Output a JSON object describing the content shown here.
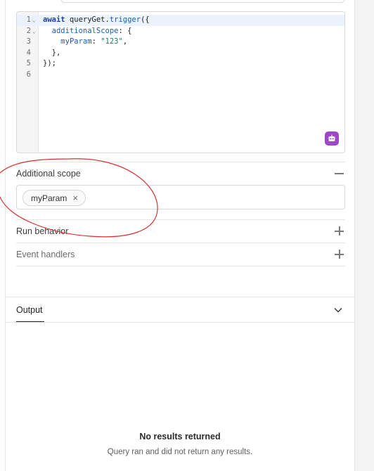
{
  "editor": {
    "lines": [
      {
        "number": "1",
        "fold": "⌄",
        "parts": [
          {
            "t": "await",
            "c": "kw"
          },
          {
            "t": " queryGet.",
            "c": ""
          },
          {
            "t": "trigger",
            "c": "prop"
          },
          {
            "t": "({",
            "c": ""
          }
        ]
      },
      {
        "number": "2",
        "fold": "⌄",
        "parts": [
          {
            "t": "  ",
            "c": ""
          },
          {
            "t": "additionalScope",
            "c": "prop"
          },
          {
            "t": ": {",
            "c": ""
          }
        ]
      },
      {
        "number": "3",
        "fold": "",
        "parts": [
          {
            "t": "    ",
            "c": ""
          },
          {
            "t": "myParam",
            "c": "prop"
          },
          {
            "t": ": ",
            "c": ""
          },
          {
            "t": "\"123\"",
            "c": "str"
          },
          {
            "t": ",",
            "c": ""
          }
        ]
      },
      {
        "number": "4",
        "fold": "",
        "parts": [
          {
            "t": "  },",
            "c": ""
          }
        ]
      },
      {
        "number": "5",
        "fold": "",
        "parts": [
          {
            "t": "});",
            "c": ""
          }
        ]
      },
      {
        "number": "6",
        "fold": "",
        "parts": []
      }
    ],
    "ai_button_icon": "assistant-icon",
    "accent_color": "#a046c9"
  },
  "sections": {
    "additional_scope": {
      "label": "Additional scope",
      "action_icon": "minus-icon"
    },
    "run_behavior": {
      "label": "Run behavior",
      "action_icon": "plus-icon"
    },
    "event_handlers": {
      "label": "Event handlers",
      "action_icon": "plus-icon"
    }
  },
  "scope_chips": [
    {
      "label": "myParam",
      "remove_icon": "close-icon"
    }
  ],
  "remove_glyph": "×",
  "annotation_color": "#d93030",
  "output": {
    "tab_label": "Output",
    "toggle_icon": "chevron-down-icon",
    "empty_title": "No results returned",
    "empty_subtitle": "Query ran and did not return any results."
  }
}
